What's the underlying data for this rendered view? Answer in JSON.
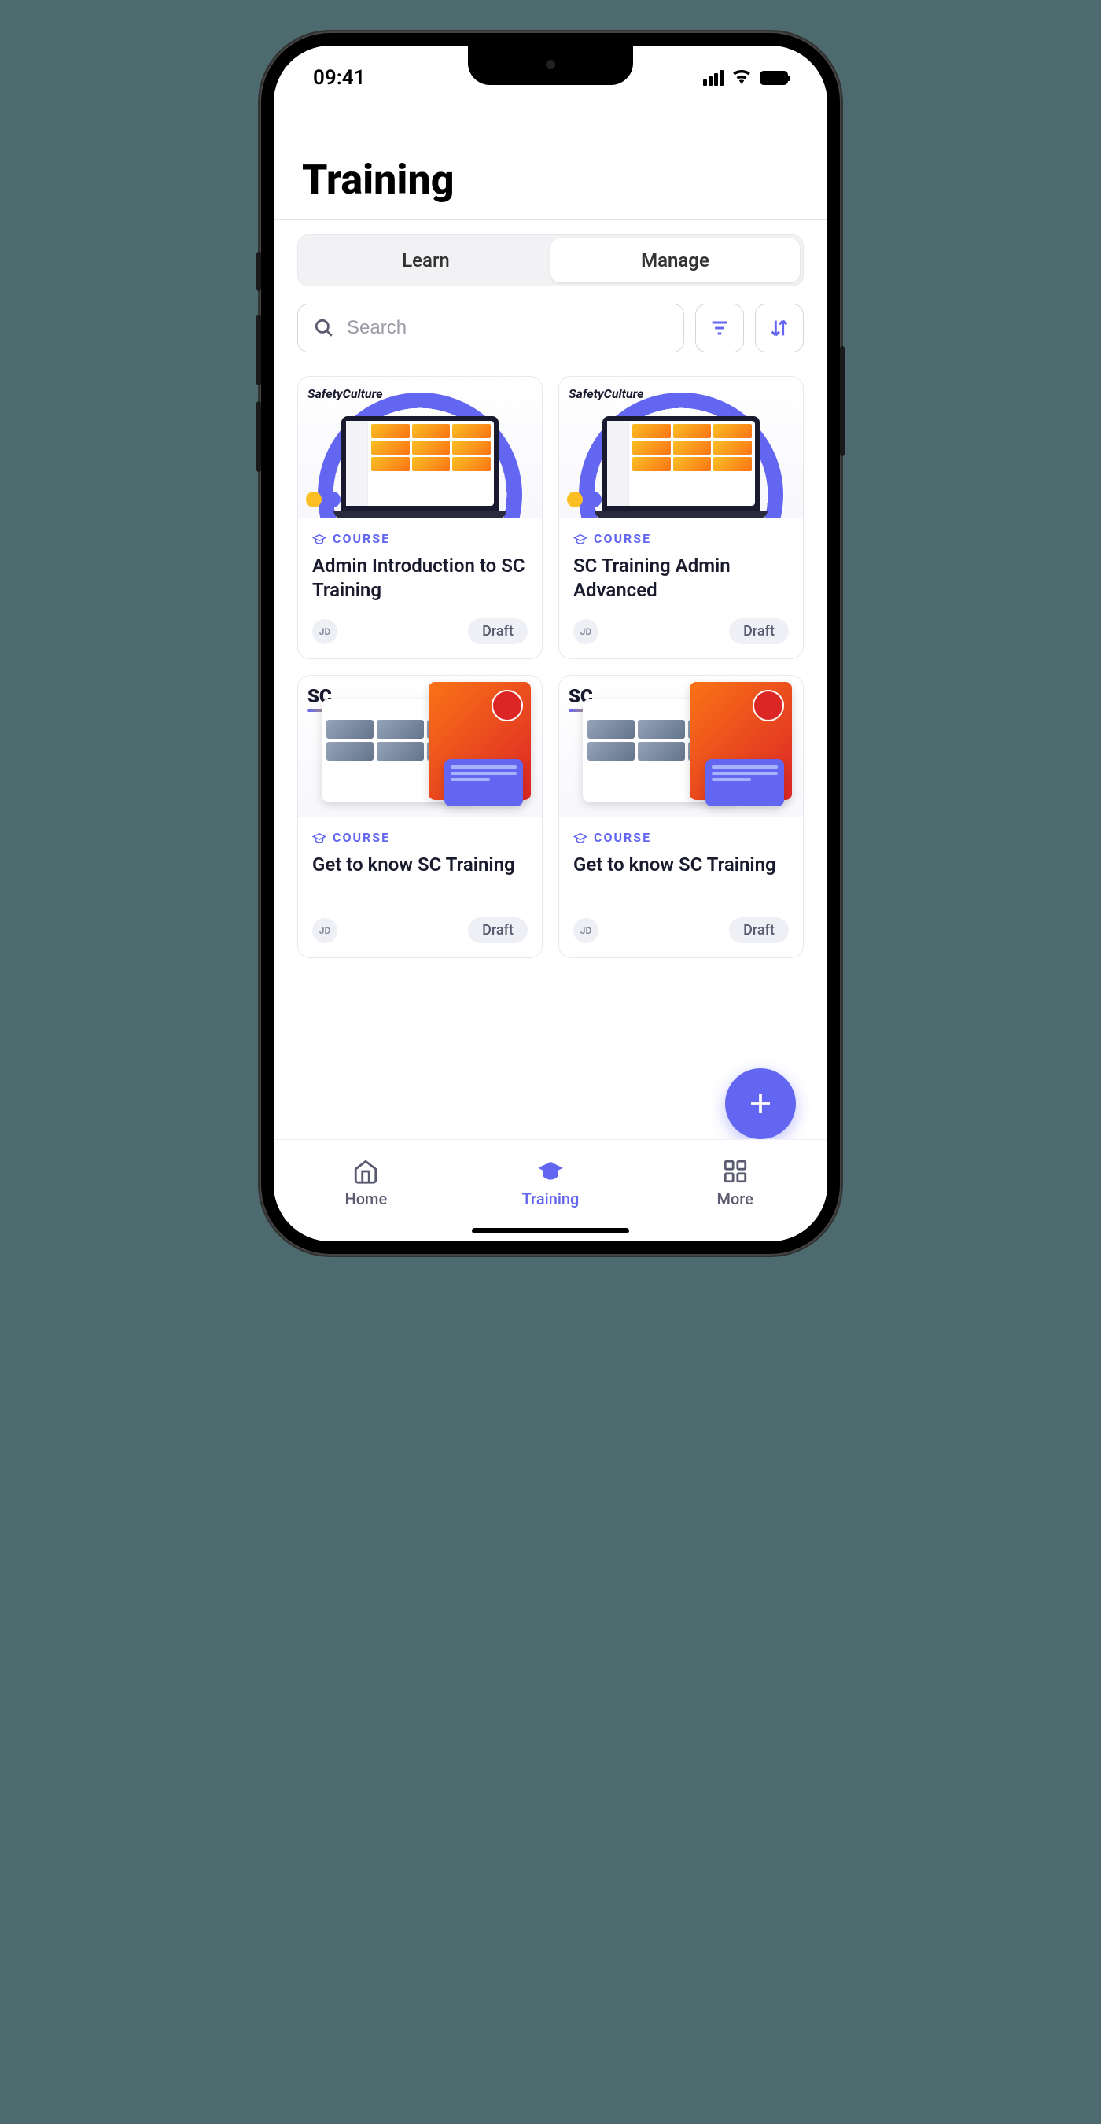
{
  "status": {
    "time": "09:41"
  },
  "page": {
    "title": "Training"
  },
  "tabs": {
    "learn": "Learn",
    "manage": "Manage"
  },
  "search": {
    "placeholder": "Search"
  },
  "badge": {
    "label": "COURSE"
  },
  "cards": [
    {
      "brand": "SafetyCulture",
      "type": "COURSE",
      "title": "Admin Introduction to SC Training",
      "author": "JD",
      "status": "Draft",
      "thumb": "laptop"
    },
    {
      "brand": "SafetyCulture",
      "type": "COURSE",
      "title": "SC Training Admin Advanced",
      "author": "JD",
      "status": "Draft",
      "thumb": "laptop"
    },
    {
      "brand": "SC",
      "type": "COURSE",
      "title": "Get to know SC Training",
      "author": "JD",
      "status": "Draft",
      "thumb": "collage"
    },
    {
      "brand": "SC",
      "type": "COURSE",
      "title": "Get to know SC Training",
      "author": "JD",
      "status": "Draft",
      "thumb": "collage"
    }
  ],
  "nav": {
    "home": "Home",
    "training": "Training",
    "more": "More"
  }
}
